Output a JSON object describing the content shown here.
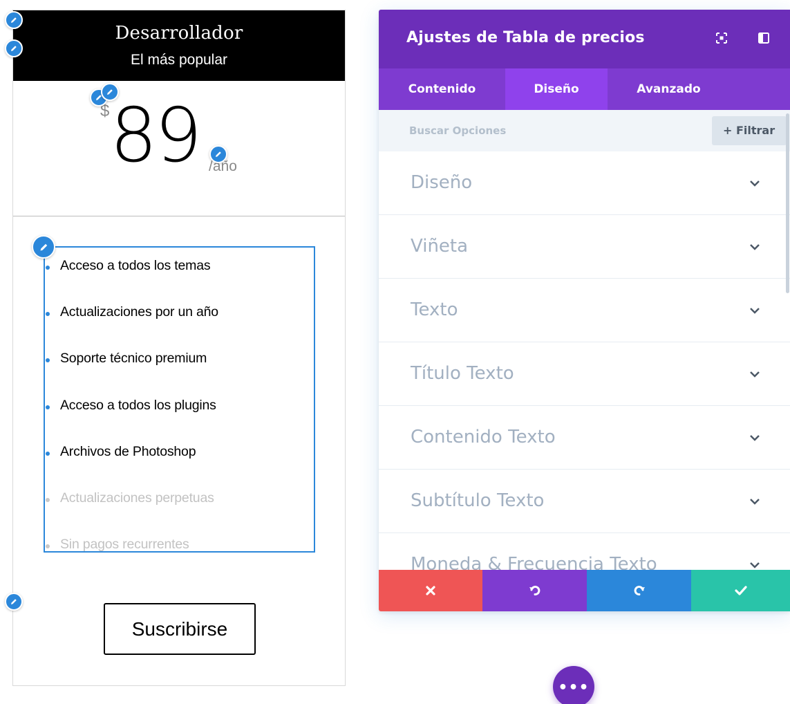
{
  "pricing_card": {
    "title": "Desarrollador",
    "subtitle": "El más popular",
    "currency": "$",
    "price": "89",
    "frequency": "/año",
    "features": [
      {
        "text": "Acceso a todos los temas",
        "included": true
      },
      {
        "text": "Actualizaciones por un año",
        "included": true
      },
      {
        "text": "Soporte técnico premium",
        "included": true
      },
      {
        "text": "Acceso a todos los plugins",
        "included": true
      },
      {
        "text": "Archivos de Photoshop",
        "included": true
      },
      {
        "text": "Actualizaciones perpetuas",
        "included": false
      },
      {
        "text": "Sin pagos recurrentes",
        "included": false
      }
    ],
    "button_label": "Suscribirse"
  },
  "settings_panel": {
    "title": "Ajustes de Tabla de precios",
    "tabs": [
      {
        "label": "Contenido",
        "active": false
      },
      {
        "label": "Diseño",
        "active": true
      },
      {
        "label": "Avanzado",
        "active": false
      }
    ],
    "search_placeholder": "Buscar Opciones",
    "filter_label": "+ Filtrar",
    "option_groups": [
      "Diseño",
      "Viñeta",
      "Texto",
      "Título Texto",
      "Contenido Texto",
      "Subtítulo Texto",
      "Moneda & Frecuencia Texto"
    ],
    "actions": [
      {
        "name": "cancel",
        "icon": "close-icon",
        "color": "#ef5555"
      },
      {
        "name": "undo",
        "icon": "undo-icon",
        "color": "#7e3bd0"
      },
      {
        "name": "redo",
        "icon": "redo-icon",
        "color": "#2b87da"
      },
      {
        "name": "save",
        "icon": "check-icon",
        "color": "#29c4a9"
      }
    ]
  },
  "fab": {
    "label": "•••",
    "icon": "more-icon"
  },
  "colors": {
    "header_purple": "#6c2eb9",
    "tab_purple": "#7e3bd0",
    "active_tab": "#8f42ec",
    "edit_blue": "#2b87da"
  }
}
